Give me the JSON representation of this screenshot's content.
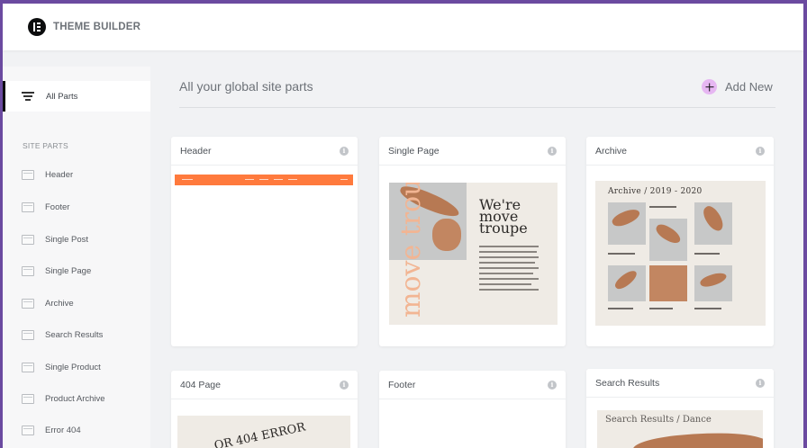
{
  "app": {
    "title": "THEME BUILDER",
    "logo_icon": "elementor-logo-icon"
  },
  "sidebar": {
    "all_parts_label": "All Parts",
    "section_label": "SITE PARTS",
    "items": [
      {
        "label": "Header",
        "icon": "header-layout-icon"
      },
      {
        "label": "Footer",
        "icon": "footer-layout-icon"
      },
      {
        "label": "Single Post",
        "icon": "single-post-icon"
      },
      {
        "label": "Single Page",
        "icon": "single-page-icon"
      },
      {
        "label": "Archive",
        "icon": "archive-icon"
      },
      {
        "label": "Search Results",
        "icon": "search-results-icon"
      },
      {
        "label": "Single Product",
        "icon": "single-product-icon"
      },
      {
        "label": "Product Archive",
        "icon": "product-archive-icon"
      },
      {
        "label": "Error 404",
        "icon": "error-404-icon"
      }
    ]
  },
  "main": {
    "title": "All your global site parts",
    "add_new_label": "Add New",
    "cards": [
      {
        "title": "Header"
      },
      {
        "title": "Single Page"
      },
      {
        "title": "Archive"
      },
      {
        "title": "404 Page"
      },
      {
        "title": "Footer"
      },
      {
        "title": "Search Results"
      }
    ],
    "info_glyph": "i"
  },
  "thumbnails": {
    "single_page_headline": "We're move troupe",
    "single_page_vertical": "move troupe",
    "archive_heading": "Archive / 2019 - 2020",
    "error_arc_text": "OR 404 ERROR",
    "search_heading": "Search Results / Dance"
  },
  "colors": {
    "accent_plus": "#e6b7f2",
    "header_strip": "#ff7a3d",
    "frame_border": "#6b4aa0"
  }
}
